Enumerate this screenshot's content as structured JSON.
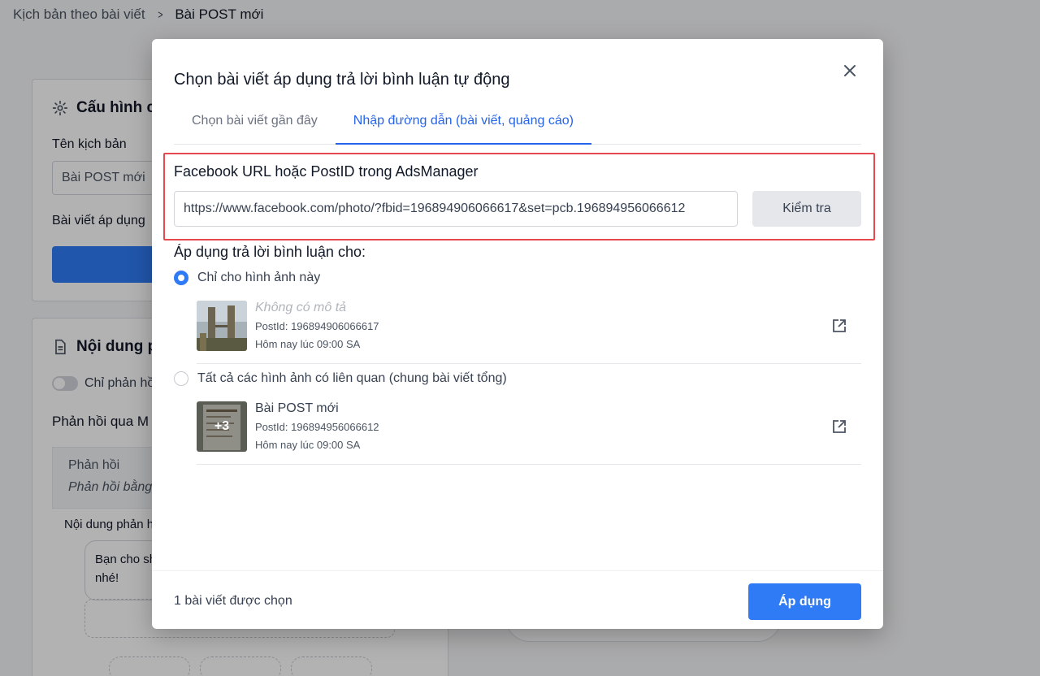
{
  "breadcrumb": {
    "parent": "Kịch bản theo bài viết",
    "current": "Bài POST mới"
  },
  "background": {
    "config_title": "Cấu hình c",
    "name_label": "Tên kịch bản",
    "name_value": "Bài POST mới",
    "applied_label": "Bài viết áp dụng",
    "content_title": "Nội dung p",
    "toggle_label": "Chỉ phản hồ",
    "reply_via": "Phản hồi qua M",
    "reply_box_title": "Phản hồi",
    "reply_box_sub": "Phản hồi bằng",
    "reply_content_label": "Nội dung phản h",
    "reply_text_line1": "Bạn cho sh",
    "reply_text_line2": "nhé!"
  },
  "modal": {
    "title": "Chọn bài viết áp dụng trả lời bình luận tự động",
    "tabs": [
      {
        "label": "Chọn bài viết gần đây",
        "active": false
      },
      {
        "label": "Nhập đường dẫn (bài viết, quảng cáo)",
        "active": true
      }
    ],
    "url_label": "Facebook URL hoặc PostID trong AdsManager",
    "url_value": "https://www.facebook.com/photo/?fbid=196894906066617&set=pcb.196894956066612",
    "check_button": "Kiểm tra",
    "apply_label": "Áp dụng trả lời bình luận cho:",
    "options": [
      {
        "label": "Chỉ cho hình ảnh này",
        "selected": true,
        "post_title": "Không có mô tả",
        "post_id": "PostId: 196894906066617",
        "time": "Hôm nay lúc 09:00 SA"
      },
      {
        "label": "Tất cả các hình ảnh có liên quan (chung bài viết tổng)",
        "selected": false,
        "post_title": "Bài POST mới",
        "post_id": "PostId: 196894956066612",
        "time": "Hôm nay lúc 09:00 SA",
        "thumb_overlay": "+3"
      }
    ],
    "footer_count": "1 bài viết được chọn",
    "apply_button": "Áp dụng"
  },
  "colors": {
    "primary": "#2f7bf5",
    "highlight": "#e5484d"
  }
}
